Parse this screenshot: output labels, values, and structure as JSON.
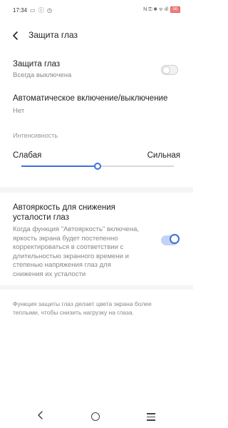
{
  "status_bar": {
    "time": "17:34",
    "left_icons": "▭ ⓘ ◷",
    "right_icons": "N ⚿ ✱ ᯤ ıll",
    "battery": "56"
  },
  "header": {
    "title": "Защита глаз"
  },
  "eye_protection": {
    "title": "Защита глаз",
    "subtitle": "Всегда выключена",
    "enabled": false
  },
  "auto_switch": {
    "title": "Автоматическое включение/выключение",
    "value": "Нет"
  },
  "intensity": {
    "section_label": "Интенсивность",
    "min_label": "Слабая",
    "max_label": "Сильная",
    "level": 0.5
  },
  "auto_brightness": {
    "title_line1": "Автояркость для снижения",
    "title_line2": "усталости глаз",
    "desc_lines": [
      "Когда функция \"Автояркость\" включена,",
      "яркость экрана будет постепенно",
      "корректироваться в соответствии с",
      "длительностью экранного времени и",
      "степенью напряжения глаз для",
      "снижения их усталости"
    ],
    "enabled": true
  },
  "footer_note": {
    "line1": "Функция защиты глаз делает цвета экрана более",
    "line2": "теплыми, чтобы снизить нагрузку на глаза."
  },
  "colors": {
    "accent": "#3d6fe0",
    "accent_light": "#c3d3f7",
    "secondary_text": "#888888"
  }
}
